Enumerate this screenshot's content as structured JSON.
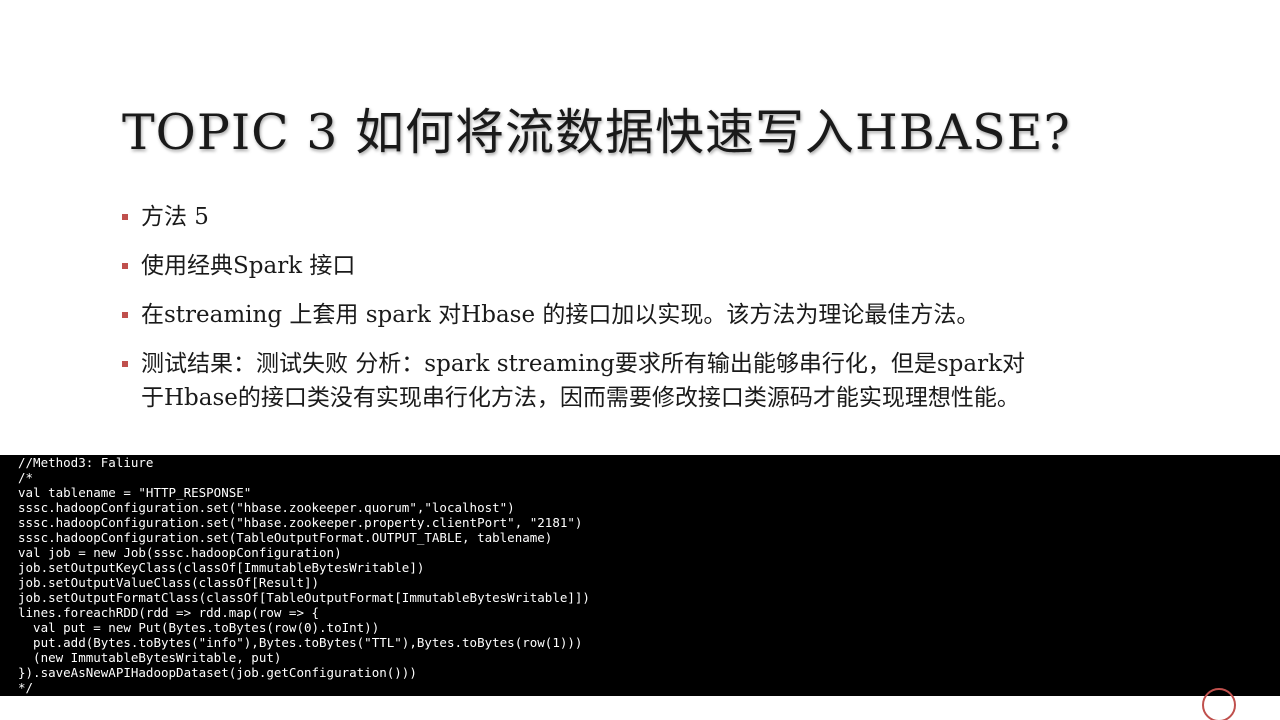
{
  "slide": {
    "title": "TOPIC 3 如何将流数据快速写入HBASE?",
    "bullets": [
      {
        "lines": [
          "方法 5"
        ]
      },
      {
        "lines": [
          "使用经典Spark 接口"
        ]
      },
      {
        "lines": [
          "在streaming 上套用 spark 对Hbase 的接口加以实现。该方法为理论最佳方法。"
        ]
      },
      {
        "lines": [
          "测试结果：测试失败 分析：spark streaming要求所有输出能够串行化，但是spark对",
          "于Hbase的接口类没有实现串行化方法，因而需要修改接口类源码才能实现理想性能。"
        ]
      }
    ],
    "code_lines": [
      "//Method3: Faliure",
      "/*",
      "val tablename = \"HTTP_RESPONSE\"",
      "sssc.hadoopConfiguration.set(\"hbase.zookeeper.quorum\",\"localhost\")",
      "sssc.hadoopConfiguration.set(\"hbase.zookeeper.property.clientPort\", \"2181\")",
      "sssc.hadoopConfiguration.set(TableOutputFormat.OUTPUT_TABLE, tablename)",
      "val job = new Job(sssc.hadoopConfiguration)",
      "job.setOutputKeyClass(classOf[ImmutableBytesWritable])",
      "job.setOutputValueClass(classOf[Result])",
      "job.setOutputFormatClass(classOf[TableOutputFormat[ImmutableBytesWritable]])",
      "lines.foreachRDD(rdd => rdd.map(row => {",
      "  val put = new Put(Bytes.toBytes(row(0).toInt))",
      "  put.add(Bytes.toBytes(\"info\"),Bytes.toBytes(\"TTL\"),Bytes.toBytes(row(1)))",
      "  (new ImmutableBytesWritable, put)",
      "}).saveAsNewAPIHadoopDataset(job.getConfiguration()))",
      "*/"
    ],
    "colors": {
      "bullet_marker": "#c0504d",
      "code_background": "#000000",
      "code_text": "#ffffff"
    }
  }
}
